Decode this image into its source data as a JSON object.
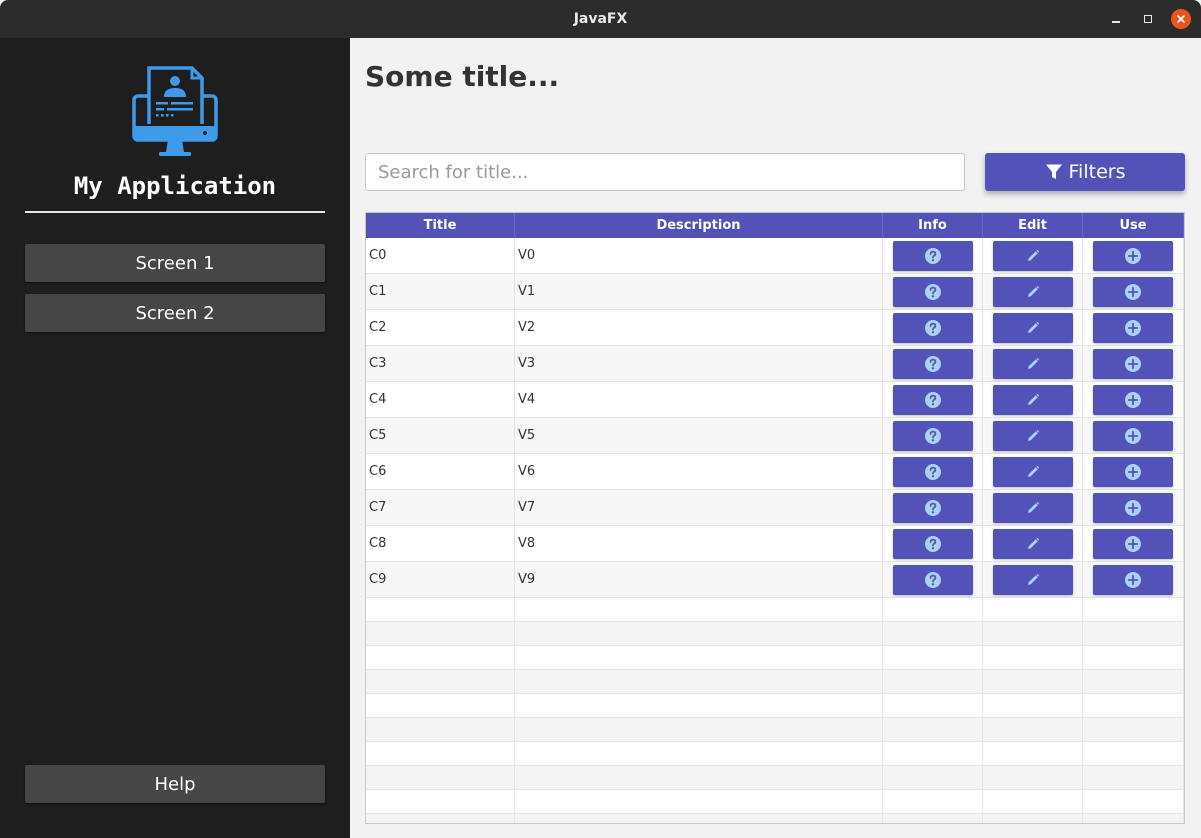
{
  "window": {
    "title": "JavaFX"
  },
  "sidebar": {
    "app_name": "My Application",
    "nav": [
      {
        "label": "Screen 1"
      },
      {
        "label": "Screen 2"
      }
    ],
    "help_label": "Help",
    "logo_icon": "computer-user-document-icon"
  },
  "main": {
    "title": "Some title...",
    "search_placeholder": "Search for title...",
    "filters_label": "Filters",
    "filters_icon": "funnel-icon"
  },
  "table": {
    "columns": [
      "Title",
      "Description",
      "Info",
      "Edit",
      "Use"
    ],
    "rows": [
      {
        "title": "C0",
        "description": "V0"
      },
      {
        "title": "C1",
        "description": "V1"
      },
      {
        "title": "C2",
        "description": "V2"
      },
      {
        "title": "C3",
        "description": "V3"
      },
      {
        "title": "C4",
        "description": "V4"
      },
      {
        "title": "C5",
        "description": "V5"
      },
      {
        "title": "C6",
        "description": "V6"
      },
      {
        "title": "C7",
        "description": "V7"
      },
      {
        "title": "C8",
        "description": "V8"
      },
      {
        "title": "C9",
        "description": "V9"
      }
    ],
    "action_icons": {
      "info": "question-circle-icon",
      "edit": "pencil-icon",
      "use": "plus-circle-icon"
    }
  },
  "colors": {
    "accent": "#5252b8",
    "sidebar_bg": "#1e1e1e",
    "sidebar_button": "#464646",
    "logo": "#3d9be9",
    "close_button": "#e95420"
  }
}
